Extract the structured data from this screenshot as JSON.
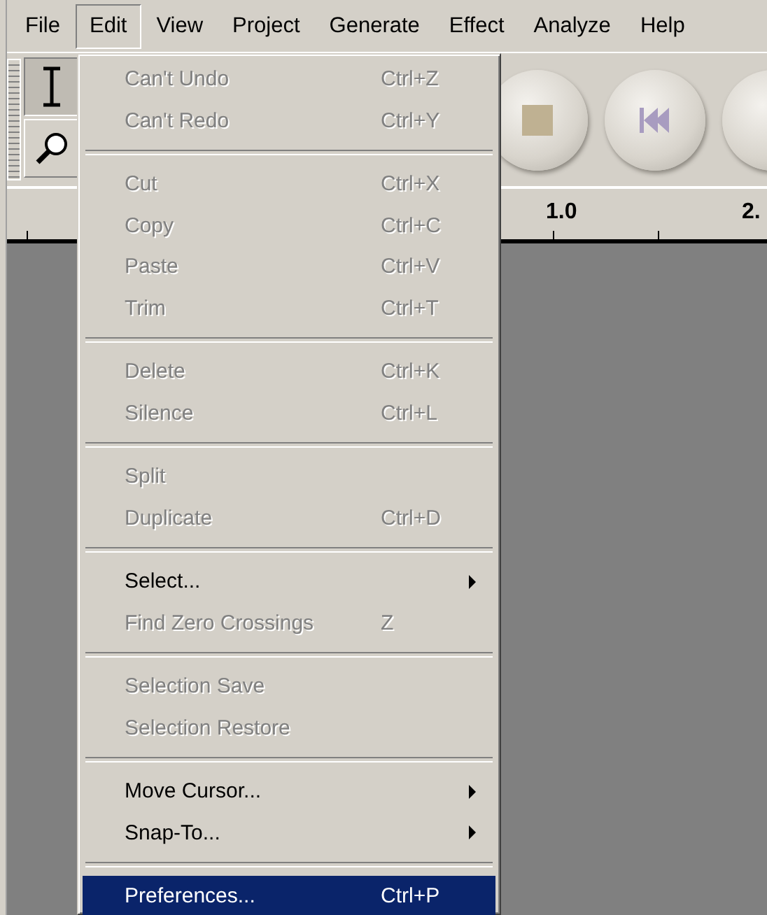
{
  "menubar": [
    {
      "label": "File",
      "selected": false
    },
    {
      "label": "Edit",
      "selected": true
    },
    {
      "label": "View",
      "selected": false
    },
    {
      "label": "Project",
      "selected": false
    },
    {
      "label": "Generate",
      "selected": false
    },
    {
      "label": "Effect",
      "selected": false
    },
    {
      "label": "Analyze",
      "selected": false
    },
    {
      "label": "Help",
      "selected": false
    }
  ],
  "ruler": {
    "labels": [
      "1.0",
      "2."
    ]
  },
  "edit_menu": {
    "sections": [
      [
        {
          "label": "Can't Undo",
          "shortcut": "Ctrl+Z",
          "disabled": true,
          "submenu": false,
          "selected": false
        },
        {
          "label": "Can't Redo",
          "shortcut": "Ctrl+Y",
          "disabled": true,
          "submenu": false,
          "selected": false
        }
      ],
      [
        {
          "label": "Cut",
          "shortcut": "Ctrl+X",
          "disabled": true,
          "submenu": false,
          "selected": false
        },
        {
          "label": "Copy",
          "shortcut": "Ctrl+C",
          "disabled": true,
          "submenu": false,
          "selected": false
        },
        {
          "label": "Paste",
          "shortcut": "Ctrl+V",
          "disabled": true,
          "submenu": false,
          "selected": false
        },
        {
          "label": "Trim",
          "shortcut": "Ctrl+T",
          "disabled": true,
          "submenu": false,
          "selected": false
        }
      ],
      [
        {
          "label": "Delete",
          "shortcut": "Ctrl+K",
          "disabled": true,
          "submenu": false,
          "selected": false
        },
        {
          "label": "Silence",
          "shortcut": "Ctrl+L",
          "disabled": true,
          "submenu": false,
          "selected": false
        }
      ],
      [
        {
          "label": "Split",
          "disabled": true,
          "submenu": false,
          "selected": false
        },
        {
          "label": "Duplicate",
          "shortcut": "Ctrl+D",
          "disabled": true,
          "submenu": false,
          "selected": false
        }
      ],
      [
        {
          "label": "Select...",
          "disabled": false,
          "submenu": true,
          "selected": false
        },
        {
          "label": "Find Zero Crossings",
          "shortcut": "Z",
          "disabled": true,
          "submenu": false,
          "selected": false
        }
      ],
      [
        {
          "label": "Selection Save",
          "disabled": true,
          "submenu": false,
          "selected": false
        },
        {
          "label": "Selection Restore",
          "disabled": true,
          "submenu": false,
          "selected": false
        }
      ],
      [
        {
          "label": "Move Cursor...",
          "disabled": false,
          "submenu": true,
          "selected": false
        },
        {
          "label": "Snap-To...",
          "disabled": false,
          "submenu": true,
          "selected": false
        }
      ],
      [
        {
          "label": "Preferences...",
          "shortcut": "Ctrl+P",
          "disabled": false,
          "submenu": false,
          "selected": true
        }
      ]
    ]
  }
}
